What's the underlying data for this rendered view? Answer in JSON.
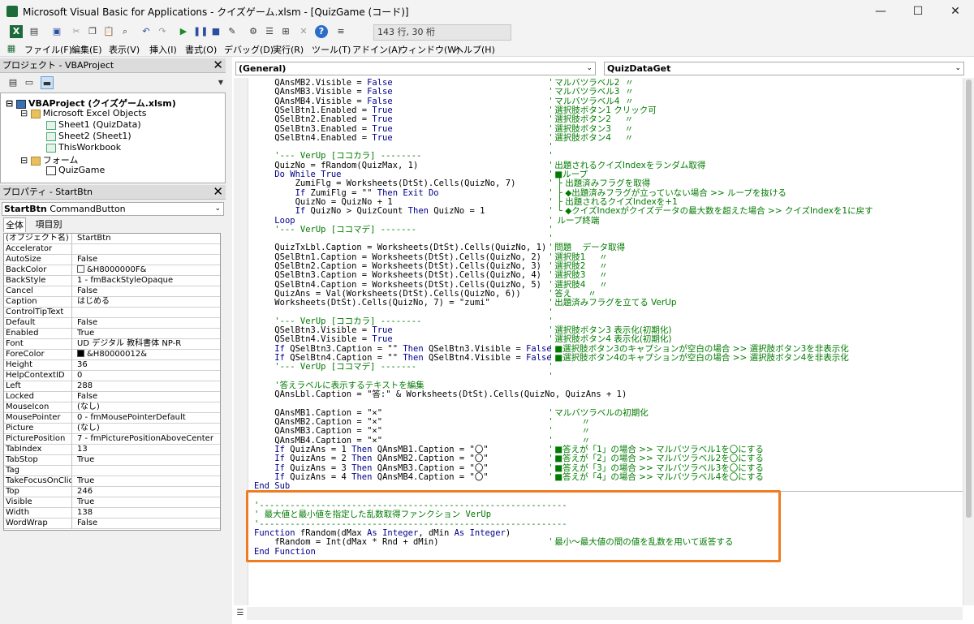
{
  "window": {
    "title": "Microsoft Visual Basic for Applications - クイズゲーム.xlsm - [QuizGame (コード)]",
    "controls": {
      "minimize": "—",
      "maximize": "☐",
      "close": "✕"
    }
  },
  "toolbar": {
    "position_text": "143 行, 30 桁",
    "icons": [
      "excel-icon",
      "insert-module-icon",
      "save-icon",
      "cut-icon",
      "copy-icon",
      "paste-icon",
      "find-icon",
      "undo-icon",
      "redo-icon",
      "run-icon",
      "break-icon",
      "reset-icon",
      "design-mode-icon",
      "project-explorer-icon",
      "properties-icon",
      "object-browser-icon",
      "toolbox-icon",
      "help-icon",
      "indent-icon"
    ]
  },
  "menu": [
    "ファイル(F)",
    "編集(E)",
    "表示(V)",
    "挿入(I)",
    "書式(O)",
    "デバッグ(D)",
    "実行(R)",
    "ツール(T)",
    "アドイン(A)",
    "ウィンドウ(W)",
    "ヘルプ(H)"
  ],
  "project": {
    "header": "プロジェクト - VBAProject",
    "root": "VBAProject (クイズゲーム.xlsm)",
    "excel_objects": "Microsoft Excel Objects",
    "sheet1": "Sheet1 (QuizData)",
    "sheet2": "Sheet2 (Sheet1)",
    "workbook": "ThisWorkbook",
    "forms_folder": "フォーム",
    "form": "QuizGame"
  },
  "properties": {
    "header": "プロパティ - StartBtn",
    "object_name": "StartBtn",
    "object_type": "CommandButton",
    "tabs": [
      "全体",
      "項目別"
    ],
    "rows": [
      {
        "name": "(オブジェクト名)",
        "value": "StartBtn"
      },
      {
        "name": "Accelerator",
        "value": ""
      },
      {
        "name": "AutoSize",
        "value": "False"
      },
      {
        "name": "BackColor",
        "value": "&H8000000F&",
        "swatch": "white"
      },
      {
        "name": "BackStyle",
        "value": "1 - fmBackStyleOpaque"
      },
      {
        "name": "Cancel",
        "value": "False"
      },
      {
        "name": "Caption",
        "value": "はじめる"
      },
      {
        "name": "ControlTipText",
        "value": ""
      },
      {
        "name": "Default",
        "value": "False"
      },
      {
        "name": "Enabled",
        "value": "True"
      },
      {
        "name": "Font",
        "value": "UD デジタル 教科書体 NP-R"
      },
      {
        "name": "ForeColor",
        "value": "&H80000012&",
        "swatch": "black"
      },
      {
        "name": "Height",
        "value": "36"
      },
      {
        "name": "HelpContextID",
        "value": "0"
      },
      {
        "name": "Left",
        "value": "288"
      },
      {
        "name": "Locked",
        "value": "False"
      },
      {
        "name": "MouseIcon",
        "value": "(なし)"
      },
      {
        "name": "MousePointer",
        "value": "0 - fmMousePointerDefault"
      },
      {
        "name": "Picture",
        "value": "(なし)"
      },
      {
        "name": "PicturePosition",
        "value": "7 - fmPicturePositionAboveCenter"
      },
      {
        "name": "TabIndex",
        "value": "13"
      },
      {
        "name": "TabStop",
        "value": "True"
      },
      {
        "name": "Tag",
        "value": ""
      },
      {
        "name": "TakeFocusOnClick",
        "value": "True"
      },
      {
        "name": "Top",
        "value": "246"
      },
      {
        "name": "Visible",
        "value": "True"
      },
      {
        "name": "Width",
        "value": "138"
      },
      {
        "name": "WordWrap",
        "value": "False"
      }
    ]
  },
  "code": {
    "object_combo": "(General)",
    "proc_combo": "QuizDataGet",
    "lines": [
      {
        "code": "    QAnsMB2.Visible = False",
        "comment": "' マルバツラベル2  〃"
      },
      {
        "code": "    QAnsMB3.Visible = False",
        "comment": "' マルバツラベル3  〃"
      },
      {
        "code": "    QAnsMB4.Visible = False",
        "comment": "' マルバツラベル4  〃"
      },
      {
        "code": "    QSelBtn1.Enabled = True",
        "comment": "' 選択肢ボタン1 クリック可"
      },
      {
        "code": "    QSelBtn2.Enabled = True",
        "comment": "' 選択肢ボタン2     〃"
      },
      {
        "code": "    QSelBtn3.Enabled = True",
        "comment": "' 選択肢ボタン3     〃"
      },
      {
        "code": "    QSelBtn4.Enabled = True",
        "comment": "' 選択肢ボタン4     〃"
      },
      {
        "code": "",
        "comment": "'"
      },
      {
        "code": "    '--- VerUp [ココカラ] --------",
        "comment": "'"
      },
      {
        "code": "    QuizNo = fRandom(QuizMax, 1)",
        "comment": "' 出題されるクイズIndexをランダム取得"
      },
      {
        "code": "    Do While True",
        "comment": "' ■ループ"
      },
      {
        "code": "        ZumiFlg = Worksheets(DtSt).Cells(QuizNo, 7)",
        "comment": "'  ├ 出題済みフラグを取得"
      },
      {
        "code": "        If ZumiFlg = \"\" Then Exit Do",
        "comment": "'  ├ ◆出題済みフラグが立っていない場合 >> ループを抜ける"
      },
      {
        "code": "        QuizNo = QuizNo + 1",
        "comment": "'  ├ 出題されるクイズIndexを+1"
      },
      {
        "code": "        If QuizNo > QuizCount Then QuizNo = 1",
        "comment": "'  └ ◆クイズIndexがクイズデータの最大数を超えた場合 >> クイズIndexを1に戻す"
      },
      {
        "code": "    Loop",
        "comment": "'  ループ終端"
      },
      {
        "code": "    '--- VerUp [ココマデ] -------",
        "comment": "'"
      },
      {
        "code": "",
        "comment": "'"
      },
      {
        "code": "    QuizTxLbl.Caption = Worksheets(DtSt).Cells(QuizNo, 1)",
        "comment": "' 問題    データ取得"
      },
      {
        "code": "    QSelBtn1.Caption = Worksheets(DtSt).Cells(QuizNo, 2)",
        "comment": "' 選択肢1     〃"
      },
      {
        "code": "    QSelBtn2.Caption = Worksheets(DtSt).Cells(QuizNo, 3)",
        "comment": "' 選択肢2     〃"
      },
      {
        "code": "    QSelBtn3.Caption = Worksheets(DtSt).Cells(QuizNo, 4)",
        "comment": "' 選択肢3     〃"
      },
      {
        "code": "    QSelBtn4.Caption = Worksheets(DtSt).Cells(QuizNo, 5)",
        "comment": "' 選択肢4     〃"
      },
      {
        "code": "    QuizAns = Val(Worksheets(DtSt).Cells(QuizNo, 6))",
        "comment": "' 答え      〃"
      },
      {
        "code": "    Worksheets(DtSt).Cells(QuizNo, 7) = \"zumi\"",
        "comment": "' 出題済みフラグを立てる VerUp"
      },
      {
        "code": "",
        "comment": "'"
      },
      {
        "code": "    '--- VerUp [ココカラ] --------",
        "comment": "'"
      },
      {
        "code": "    QSelBtn3.Visible = True",
        "comment": "' 選択肢ボタン3 表示化(初期化)"
      },
      {
        "code": "    QSelBtn4.Visible = True",
        "comment": "' 選択肢ボタン4 表示化(初期化)"
      },
      {
        "code": "    If QSelBtn3.Caption = \"\" Then QSelBtn3.Visible = False",
        "comment": "' ■選択肢ボタン3のキャプションが空白の場合 >> 選択肢ボタン3を非表示化"
      },
      {
        "code": "    If QSelBtn4.Caption = \"\" Then QSelBtn4.Visible = False",
        "comment": "' ■選択肢ボタン4のキャプションが空白の場合 >> 選択肢ボタン4を非表示化"
      },
      {
        "code": "    '--- VerUp [ココマデ] -------",
        "comment": "'"
      },
      {
        "code": "",
        "comment": "'"
      },
      {
        "code": "    '答えラベルに表示するテキストを編集",
        "comment": ""
      },
      {
        "code": "    QAnsLbl.Caption = \"答:\" & Worksheets(DtSt).Cells(QuizNo, QuizAns + 1)",
        "comment": ""
      },
      {
        "code": "",
        "comment": ""
      },
      {
        "code": "    QAnsMB1.Caption = \"×\"",
        "comment": "' マルバツラベルの初期化"
      },
      {
        "code": "    QAnsMB2.Caption = \"×\"",
        "comment": "'           〃"
      },
      {
        "code": "    QAnsMB3.Caption = \"×\"",
        "comment": "'           〃"
      },
      {
        "code": "    QAnsMB4.Caption = \"×\"",
        "comment": "'           〃"
      },
      {
        "code": "    If QuizAns = 1 Then QAnsMB1.Caption = \"〇\"",
        "comment": "' ■答えが「1」の場合 >> マルバツラベル1を〇にする"
      },
      {
        "code": "    If QuizAns = 2 Then QAnsMB2.Caption = \"〇\"",
        "comment": "' ■答えが「2」の場合 >> マルバツラベル2を〇にする"
      },
      {
        "code": "    If QuizAns = 3 Then QAnsMB3.Caption = \"〇\"",
        "comment": "' ■答えが「3」の場合 >> マルバツラベル3を〇にする"
      },
      {
        "code": "    If QuizAns = 4 Then QAnsMB4.Caption = \"〇\"",
        "comment": "' ■答えが「4」の場合 >> マルバツラベル4を〇にする"
      },
      {
        "code": "End Sub",
        "comment": ""
      }
    ],
    "function_lines": [
      {
        "code": "'------------------------------------------------------------",
        "comment": ""
      },
      {
        "code": "' 最大値と最小値を指定した乱数取得ファンクション VerUp",
        "comment": ""
      },
      {
        "code": "'------------------------------------------------------------",
        "comment": ""
      },
      {
        "code": "Function fRandom(dMax As Integer, dMin As Integer)",
        "comment": ""
      },
      {
        "code": "    fRandom = Int(dMax * Rnd + dMin)",
        "comment": "' 最小～最大値の間の値を乱数を用いて返答する"
      },
      {
        "code": "End Function",
        "comment": ""
      }
    ]
  },
  "colors": {
    "keyword": "#00008b",
    "comment": "#007a00",
    "highlight": "#f07c22"
  }
}
